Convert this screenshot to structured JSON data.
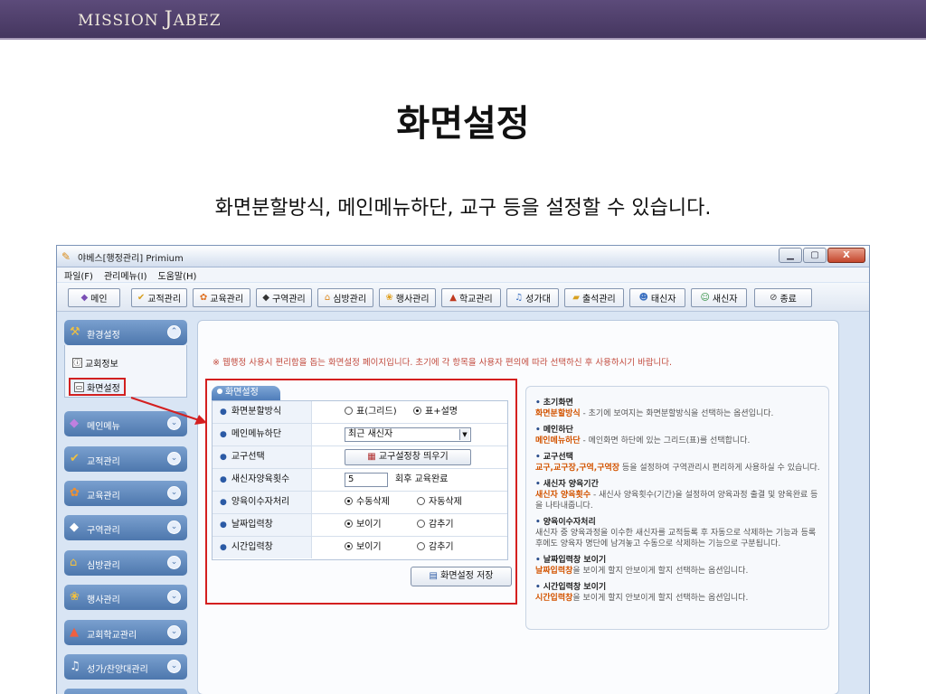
{
  "brand": {
    "m": "M",
    "ission": "ISSION",
    "j": "J",
    "abez": "ABEZ"
  },
  "slide": {
    "title": "화면설정",
    "subtitle": "화면분할방식, 메인메뉴하단, 교구 등을 설정할 수 있습니다."
  },
  "window": {
    "title": "야베스[행정관리] Primium",
    "controls": {
      "minimize": "▁",
      "maximize": "▢",
      "close": "X"
    }
  },
  "menubar": [
    "파일(F)",
    "관리메뉴(I)",
    "도움말(H)"
  ],
  "toolbar": [
    {
      "label": "메인",
      "icon": "gem-icon"
    },
    {
      "label": "교적관리",
      "icon": "check-icon"
    },
    {
      "label": "교육관리",
      "icon": "flower-icon"
    },
    {
      "label": "구역관리",
      "icon": "diamond-icon"
    },
    {
      "label": "심방관리",
      "icon": "house-icon"
    },
    {
      "label": "행사관리",
      "icon": "party-icon"
    },
    {
      "label": "학교관리",
      "icon": "school-icon"
    },
    {
      "label": "성가대",
      "icon": "music-icon"
    },
    {
      "label": "출석관리",
      "icon": "folder-icon"
    },
    {
      "label": "태신자",
      "icon": "people-icon"
    },
    {
      "label": "새신자",
      "icon": "users-icon"
    },
    {
      "label": "종료",
      "icon": "stop-icon"
    }
  ],
  "sidebar": {
    "open_group": "환경설정",
    "sub_items": [
      "교회정보",
      "화면설정"
    ],
    "groups": [
      "메인메뉴",
      "교적관리",
      "교육관리",
      "구역관리",
      "심방관리",
      "행사관리",
      "교회학교관리",
      "성가/찬양대관리"
    ]
  },
  "main": {
    "notice": "※ 웹행정 사용시 편리함을 돕는 화면설정 페이지입니다. 초기에 각 항목을 사용자 편의에 따라 선택하신 후 사용하시기 바랍니다.",
    "tab": "화면설정",
    "rows": {
      "split": {
        "label": "화면분할방식",
        "opt1": "표(그리드)",
        "opt2": "표+설명",
        "selected": 2
      },
      "menu": {
        "label": "메인메뉴하단",
        "value": "최근 새신자"
      },
      "church": {
        "label": "교구선택",
        "button": "교구설정창 띄우기"
      },
      "count": {
        "label": "새신자양육횟수",
        "value": "5",
        "suffix": "회후 교육완료"
      },
      "process": {
        "label": "양육이수자처리",
        "opt1": "수동삭제",
        "opt2": "자동삭제",
        "selected": 1
      },
      "date": {
        "label": "날짜입력창",
        "opt1": "보이기",
        "opt2": "감추기",
        "selected": 1
      },
      "time": {
        "label": "시간입력창",
        "opt1": "보이기",
        "opt2": "감추기",
        "selected": 1
      }
    },
    "save": "화면설정 저장"
  },
  "help": [
    {
      "title": "초기화면",
      "hl": "화면분할방식",
      "text": " - 초기에 보여지는 화면분할방식을 선택하는 옵션입니다."
    },
    {
      "title": "메인하단",
      "hl": "메인메뉴하단",
      "text": " - 메인화면 하단에 있는 그리드(표)를 선택합니다."
    },
    {
      "title": "교구선택",
      "hl": "교구,교구장,구역,구역장",
      "text": " 등을 설정하여 구역관리시 편리하게 사용하실 수 있습니다."
    },
    {
      "title": "새신자 양육기간",
      "hl": "새신자 양육횟수",
      "text": " - 새신사 양육횟수(기간)을 설정하여 양육과정 출결 및 양육완료 등을 나타내줍니다."
    },
    {
      "title": "양육이수자처리",
      "hl": "",
      "text": "새신자 중 양육과정을 이수한 새신자를 교적등록 후 자동으로 삭제하는 기능과 등록 후에도 양육자 명단에 남겨놓고 수동으로 삭제하는 기능으로 구분됩니다."
    },
    {
      "title": "날짜입력창 보이기",
      "hl": "날짜입력창",
      "text": "을 보이게 할지 안보이게 할지 선택하는 옵션입니다."
    },
    {
      "title": "시간입력창 보이기",
      "hl": "시간입력창",
      "text": "을 보이게 할지 안보이게 할지 선택하는 옵션입니다."
    }
  ],
  "colors": {
    "accent_red": "#d41f1f",
    "sidebar_blue": "#4d77ad",
    "notice": "#c24a3d",
    "highlight": "#d35400"
  }
}
